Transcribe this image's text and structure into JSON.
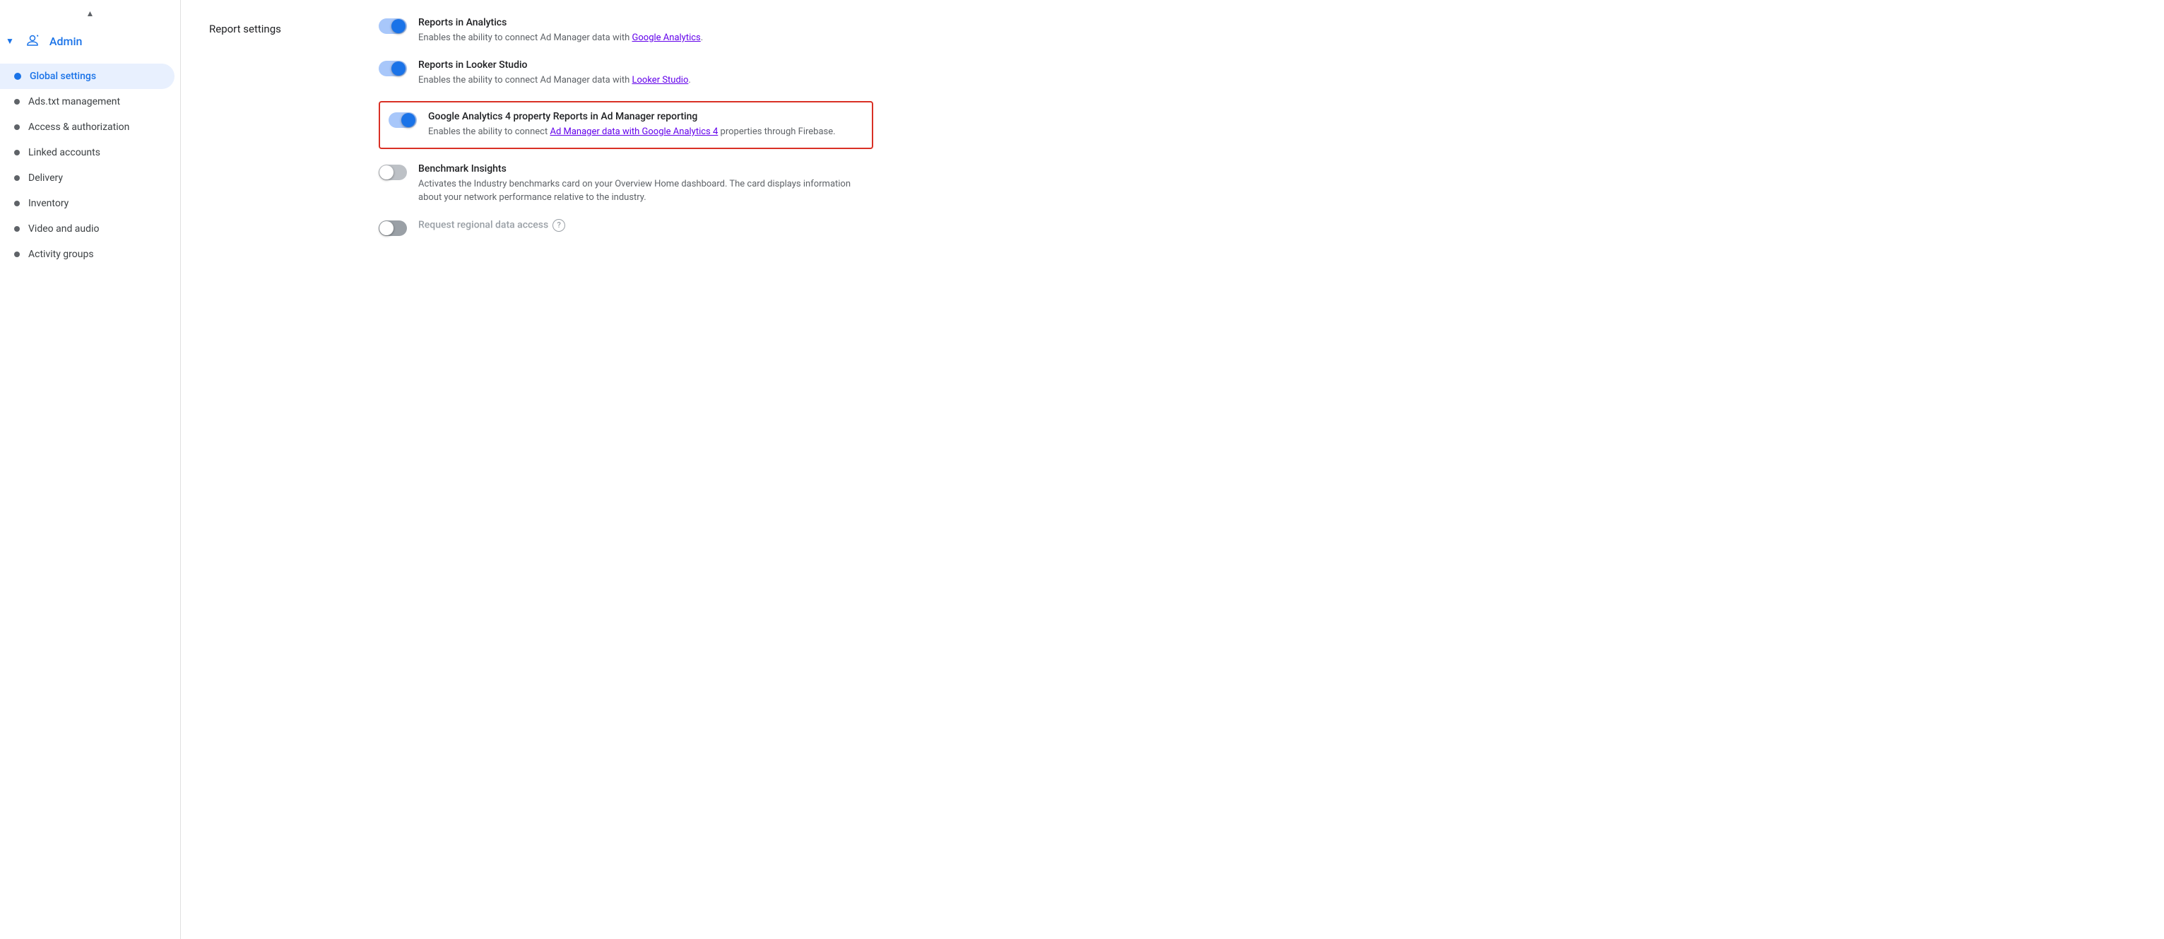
{
  "sidebar": {
    "admin_label": "Admin",
    "items": [
      {
        "id": "global-settings",
        "label": "Global settings",
        "active": true
      },
      {
        "id": "ads-txt",
        "label": "Ads.txt management",
        "active": false
      },
      {
        "id": "access-auth",
        "label": "Access & authorization",
        "active": false
      },
      {
        "id": "linked-accounts",
        "label": "Linked accounts",
        "active": false
      },
      {
        "id": "delivery",
        "label": "Delivery",
        "active": false
      },
      {
        "id": "inventory",
        "label": "Inventory",
        "active": false
      },
      {
        "id": "video-audio",
        "label": "Video and audio",
        "active": false
      },
      {
        "id": "activity-groups",
        "label": "Activity groups",
        "active": false
      }
    ]
  },
  "main": {
    "section_title": "Report settings",
    "settings": [
      {
        "id": "reports-analytics",
        "title": "Reports in Analytics",
        "description_prefix": "Enables the ability to connect Ad Manager data with ",
        "link_text": "Google Analytics",
        "description_suffix": ".",
        "enabled": true,
        "highlighted": false,
        "disabled": false
      },
      {
        "id": "reports-looker",
        "title": "Reports in Looker Studio",
        "description_prefix": "Enables the ability to connect Ad Manager data with ",
        "link_text": "Looker Studio",
        "description_suffix": ".",
        "enabled": true,
        "highlighted": false,
        "disabled": false
      },
      {
        "id": "ga4-reports",
        "title": "Google Analytics 4 property Reports in Ad Manager reporting",
        "description_prefix": "Enables the ability to connect ",
        "link_text": "Ad Manager data with Google Analytics 4",
        "description_suffix": " properties through Firebase.",
        "enabled": true,
        "highlighted": true,
        "disabled": false
      },
      {
        "id": "benchmark-insights",
        "title": "Benchmark Insights",
        "description": "Activates the Industry benchmarks card on your Overview Home dashboard. The card displays information about your network performance relative to the industry.",
        "enabled": false,
        "highlighted": false,
        "disabled": false
      },
      {
        "id": "regional-data",
        "title": "Request regional data access",
        "has_help": true,
        "enabled": false,
        "highlighted": false,
        "disabled": true
      }
    ]
  }
}
